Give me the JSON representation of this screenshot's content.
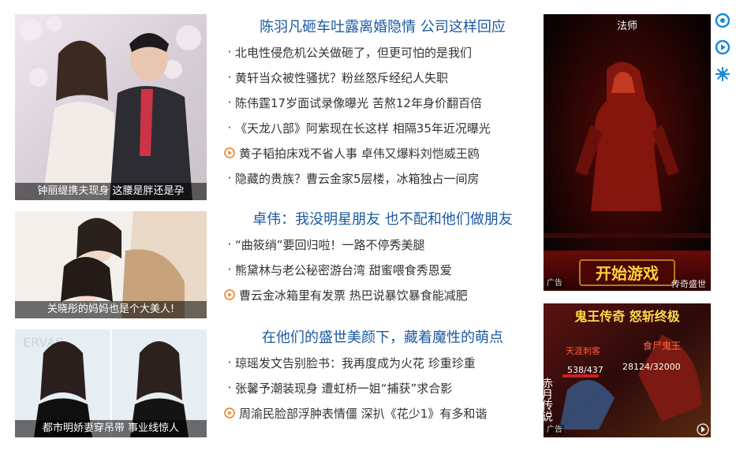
{
  "photos": [
    {
      "caption": "钟丽缇携夫现身 这腰是胖还是孕"
    },
    {
      "caption": "关晓彤的妈妈也是个大美人!"
    },
    {
      "caption": "都市明娇妻穿吊带 事业线惊人"
    }
  ],
  "sections": [
    {
      "title": "陈羽凡砸车吐露离婚隐情 公司这样回应",
      "items": [
        {
          "text": "北电性侵危机公关做砸了，但更可怕的是我们",
          "video": false
        },
        {
          "text": "黄轩当众被性骚扰？粉丝怒斥经纪人失职",
          "video": false
        },
        {
          "text": "陈伟霆17岁面试录像曝光 苦熬12年身价翻百倍",
          "video": false
        },
        {
          "text": "《天龙八部》阿紫现在长这样 相隔35年近况曝光",
          "video": false
        },
        {
          "text": "黄子韬拍床戏不省人事 卓伟又爆料刘恺威王鸥",
          "video": true
        },
        {
          "text": "隐藏的贵族？曹云金家5层楼，冰箱独占一间房",
          "video": false
        }
      ]
    },
    {
      "title": "卓伟：我没明星朋友 也不配和他们做朋友",
      "items": [
        {
          "text": "“曲筱绡”要回归啦！一路不停秀美腿",
          "video": false
        },
        {
          "text": "熊黛林与老公秘密游台湾 甜蜜喂食秀恩爱",
          "video": false
        },
        {
          "text": "曹云金冰箱里有发票 热巴说暴饮暴食能减肥",
          "video": true
        }
      ]
    },
    {
      "title": "在他们的盛世美颜下，藏着魔性的萌点",
      "items": [
        {
          "text": "琼瑶发文告别脸书：我再度成为火花 珍重珍重",
          "video": false
        },
        {
          "text": "张馨予潮装现身 遭虹桥一姐“捕获”求合影",
          "video": false
        },
        {
          "text": "周渝民脸部浮肿表情僵 深扒《花少1》有多和谐",
          "video": true
        }
      ]
    }
  ],
  "ads": [
    {
      "top_text": "法师",
      "button": "开始游戏",
      "brand": "传奇盛世",
      "tag": "广告"
    },
    {
      "title": "鬼王传奇 怒斩终极",
      "left_label": "天涯刺客",
      "right_label": "食尸鬼王",
      "hp_left": "538/437",
      "hp_right": "28124/32000",
      "side_text": "赤月传说",
      "tag": "广告"
    }
  ],
  "side_icons": [
    "weibo-icon",
    "video-icon",
    "settings-icon"
  ]
}
